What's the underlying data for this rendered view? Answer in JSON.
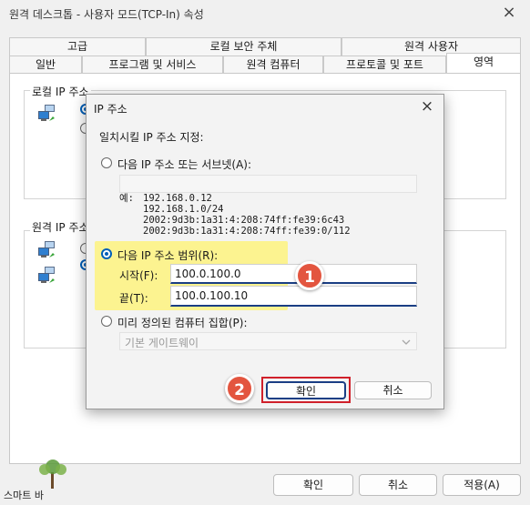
{
  "window": {
    "title": "원격 데스크톱 - 사용자 모드(TCP-In) 속성",
    "close_glyph": "×"
  },
  "tabs_row1": [
    "고급",
    "로컬 보안 주체",
    "원격 사용자"
  ],
  "tabs_row2": [
    "일반",
    "프로그램 및 서비스",
    "원격 컴퓨터",
    "프로토콜 및 포트",
    "영역"
  ],
  "active_tab": "영역",
  "local_group": {
    "label": "로컬 IP 주소"
  },
  "remote_group": {
    "label": "원격 IP 주소"
  },
  "footer": {
    "ok": "확인",
    "cancel": "취소",
    "apply": "적용(A)"
  },
  "watermark": {
    "text": "스마트 바"
  },
  "dialog": {
    "title": "IP 주소",
    "close_glyph": "×",
    "prompt": "일치시킬 IP 주소 지정:",
    "option_subnet": "다음 IP 주소 또는 서브넷(A):",
    "example_label": "예:",
    "examples": [
      "192.168.0.12",
      "192.168.1.0/24",
      "2002:9d3b:1a31:4:208:74ff:fe39:6c43",
      "2002:9d3b:1a31:4:208:74ff:fe39:0/112"
    ],
    "option_range": "다음 IP 주소 범위(R):",
    "from_label": "시작(F):",
    "from_value": "100.0.100.0",
    "to_label": "끝(T):",
    "to_value": "100.0.100.10",
    "option_predefined": "미리 정의된 컴퓨터 집합(P):",
    "predefined_value": "기본 게이트웨이",
    "ok": "확인",
    "cancel": "취소"
  },
  "badges": [
    "1",
    "2"
  ],
  "colors": {
    "highlight": "#fff36a",
    "badge": "#e3553f",
    "ok_outline": "#d0202a",
    "accent": "#005fb8"
  }
}
